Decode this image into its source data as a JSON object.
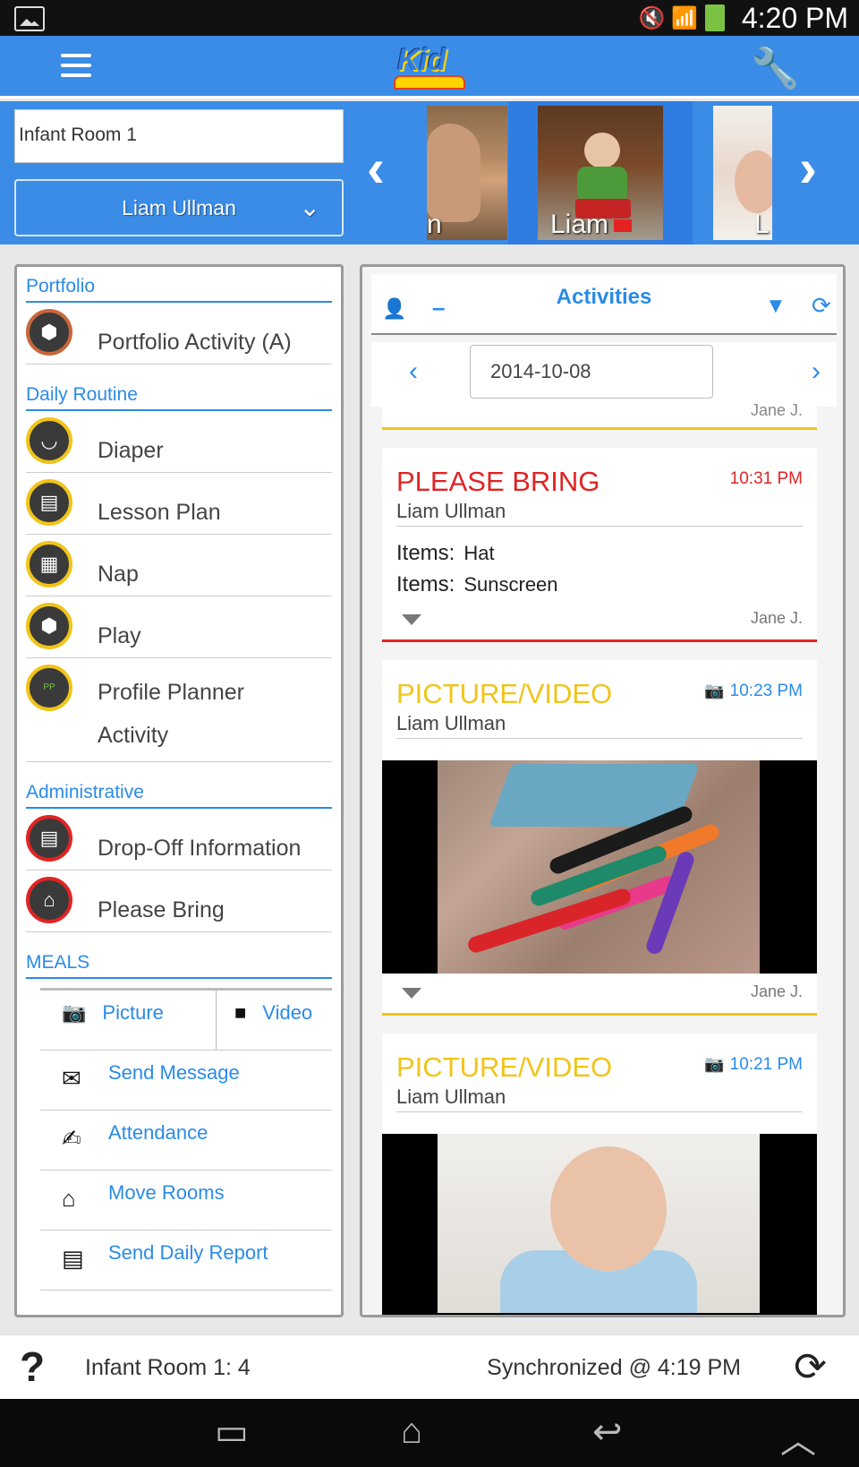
{
  "status_bar": {
    "time": "4:20 PM",
    "icons": "🔇 📶"
  },
  "app_bar": {
    "logo_text": "Kid",
    "menu_icon": "hamburger-icon",
    "settings_icon": "wrench-icon"
  },
  "selector": {
    "room_value": "Infant Room 1",
    "child_name": "Liam Ullman",
    "thumbnails": [
      {
        "label": "n"
      },
      {
        "label": "Liam"
      },
      {
        "label": "L"
      }
    ]
  },
  "left_panel": {
    "sections": {
      "portfolio": "Portfolio",
      "daily_routine": "Daily Routine",
      "administrative": "Administrative",
      "meals": "MEALS"
    },
    "portfolio_items": [
      {
        "label": "Portfolio Activity (A)",
        "icon": "blocks-icon"
      }
    ],
    "daily_items": [
      {
        "label": "Diaper",
        "icon": "diaper-icon"
      },
      {
        "label": "Lesson Plan",
        "icon": "book-icon"
      },
      {
        "label": "Nap",
        "icon": "crib-icon"
      },
      {
        "label": "Play",
        "icon": "blocks-icon"
      },
      {
        "label": "Profile Planner",
        "label2": "Activity",
        "icon": "profile-planner-icon"
      }
    ],
    "admin_items": [
      {
        "label": "Drop-Off Information",
        "icon": "clipboard-icon"
      },
      {
        "label": "Please Bring",
        "icon": "bag-icon"
      }
    ],
    "media": {
      "picture": "Picture",
      "video": "Video"
    },
    "tools": [
      {
        "label": "Send Message",
        "icon": "envelope-icon"
      },
      {
        "label": "Attendance",
        "icon": "attendance-icon"
      },
      {
        "label": "Move Rooms",
        "icon": "house-icon"
      },
      {
        "label": "Send Daily Report",
        "icon": "report-icon"
      }
    ]
  },
  "activities": {
    "title": "Activities",
    "date": "2014-10-08",
    "partial_tail": "Jane J.",
    "cards": [
      {
        "type": "PLEASE BRING",
        "time": "10:31 PM",
        "child": "Liam Ullman",
        "items_label": "Items:",
        "items": [
          "Hat",
          "Sunscreen"
        ],
        "by": "Jane J."
      },
      {
        "type": "PICTURE/VIDEO",
        "time": "10:23 PM",
        "child": "Liam Ullman",
        "by": "Jane J."
      },
      {
        "type": "PICTURE/VIDEO",
        "time": "10:21 PM",
        "child": "Liam Ullman"
      }
    ]
  },
  "bottom_bar": {
    "room_count": "Infant Room 1: 4",
    "sync_status": "Synchronized @ 4:19 PM",
    "help_symbol": "?"
  },
  "colors": {
    "accent": "#3a8ce6",
    "link": "#2a8be8",
    "please_bring": "#e02424",
    "picture_video": "#f0c419"
  }
}
